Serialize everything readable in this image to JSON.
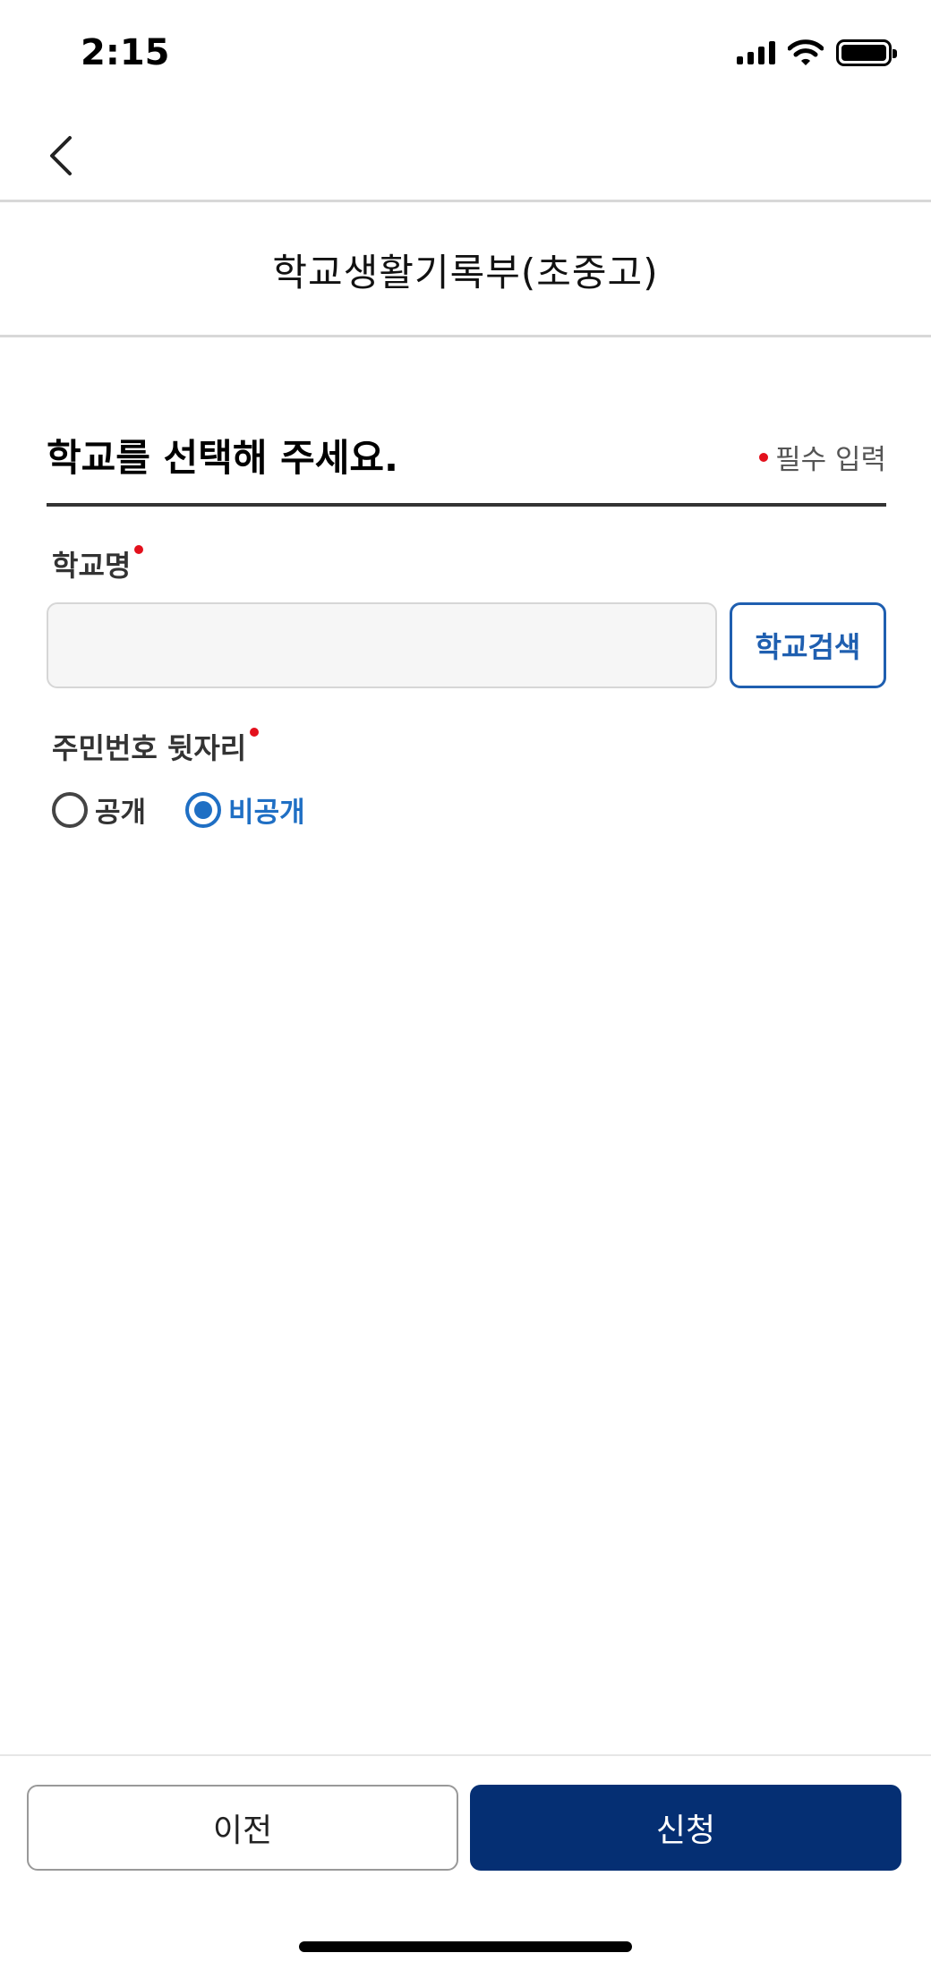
{
  "status_bar": {
    "time": "2:15",
    "icons": [
      "signal-icon",
      "wifi-icon",
      "battery-icon"
    ]
  },
  "nav": {
    "back_icon": "chevron-left-icon"
  },
  "header": {
    "title": "학교생활기록부(초중고)"
  },
  "section": {
    "title": "학교를 선택해 주세요.",
    "required_note": "필수 입력"
  },
  "fields": {
    "school_name": {
      "label": "학교명",
      "value": "",
      "placeholder": ""
    },
    "school_search_button": "학교검색",
    "rrn_suffix": {
      "label": "주민번호 뒷자리",
      "options": [
        {
          "label": "공개",
          "selected": false
        },
        {
          "label": "비공개",
          "selected": true
        }
      ]
    }
  },
  "footer": {
    "prev_label": "이전",
    "submit_label": "신청"
  },
  "colors": {
    "primary": "#052f73",
    "accent_blue": "#1f6fc4",
    "required_red": "#e3101c"
  }
}
